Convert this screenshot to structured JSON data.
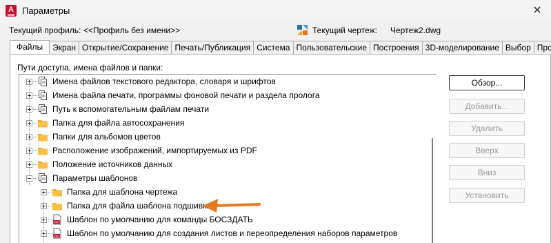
{
  "window": {
    "title": "Параметры",
    "app_icon_letter": "A"
  },
  "profile": {
    "label": "Текущий профиль:",
    "value": "<<Профиль без имени>>",
    "drawing_label": "Текущий чертеж:",
    "drawing_value": "Чертеж2.dwg"
  },
  "tabs": [
    {
      "label": "Файлы",
      "active": true
    },
    {
      "label": "Экран"
    },
    {
      "label": "Открытие/Сохранение"
    },
    {
      "label": "Печать/Публикация"
    },
    {
      "label": "Система"
    },
    {
      "label": "Пользовательские"
    },
    {
      "label": "Построения"
    },
    {
      "label": "3D-моделирование"
    },
    {
      "label": "Выбор"
    },
    {
      "label": "Профили"
    }
  ],
  "paths_label": "Пути доступа, имена файлов и папки:",
  "tree": [
    {
      "label": "Имена файлов текстового редактора, словаря и шрифтов",
      "icon": "files",
      "level": 0,
      "exp": "plus"
    },
    {
      "label": "Имена файла печати, программы фоновой печати и раздела пролога",
      "icon": "files",
      "level": 0,
      "exp": "plus"
    },
    {
      "label": "Путь к вспомогательным файлам печати",
      "icon": "files",
      "level": 0,
      "exp": "plus"
    },
    {
      "label": "Папка для файла автосохранения",
      "icon": "folder",
      "level": 0,
      "exp": "plus"
    },
    {
      "label": "Папки для альбомов цветов",
      "icon": "folder",
      "level": 0,
      "exp": "plus"
    },
    {
      "label": "Расположение изображений, импортируемых из PDF",
      "icon": "folder",
      "level": 0,
      "exp": "plus"
    },
    {
      "label": "Положение источников данных",
      "icon": "folder",
      "level": 0,
      "exp": "plus"
    },
    {
      "label": "Параметры шаблонов",
      "icon": "files",
      "level": 0,
      "exp": "minus"
    },
    {
      "label": "Папка для шаблона чертежа",
      "icon": "folder",
      "level": 1,
      "exp": "plus"
    },
    {
      "label": "Папка для файла шаблона подшивки",
      "icon": "folder",
      "level": 1,
      "exp": "plus"
    },
    {
      "label": "Шаблон по умолчанию для команды БОСЗДАТЬ",
      "icon": "dwt",
      "level": 1,
      "exp": "plus"
    },
    {
      "label": "Шаблон по умолчанию для создания листов и переопределения наборов параметров",
      "icon": "dwt",
      "level": 1,
      "exp": "plus"
    }
  ],
  "buttons": {
    "browse": "Обзор...",
    "add": "Добавить...",
    "remove": "Удалить",
    "up": "Вверх",
    "down": "Вниз",
    "set": "Установить"
  },
  "icons": {
    "close": "close-icon",
    "folder": "folder-icon",
    "files": "files-icon",
    "dwt": "dwt-file-icon",
    "arrow": "orange-arrow-icon"
  },
  "colors": {
    "accent": "#e87722",
    "folder": "#f5a623",
    "brand": "#c8102e"
  }
}
